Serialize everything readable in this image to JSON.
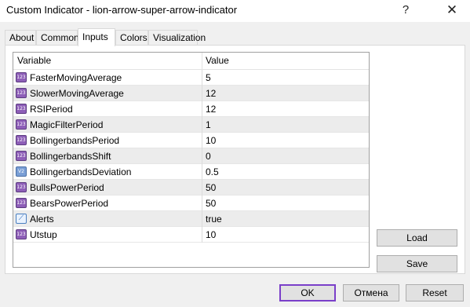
{
  "window": {
    "title": "Custom Indicator - lion-arrow-super-arrow-indicator",
    "help_glyph": "?",
    "close_glyph": "✕"
  },
  "tabs": [
    {
      "label": "About"
    },
    {
      "label": "Common"
    },
    {
      "label": "Inputs",
      "active": true
    },
    {
      "label": "Colors"
    },
    {
      "label": "Visualization"
    }
  ],
  "grid": {
    "headers": {
      "variable": "Variable",
      "value": "Value"
    },
    "rows": [
      {
        "icon": "int-icon",
        "badge": "123",
        "name": "FasterMovingAverage",
        "value": "5"
      },
      {
        "icon": "int-icon",
        "badge": "123",
        "name": "SlowerMovingAverage",
        "value": "12"
      },
      {
        "icon": "int-icon",
        "badge": "123",
        "name": "RSIPeriod",
        "value": "12"
      },
      {
        "icon": "int-icon",
        "badge": "123",
        "name": "MagicFilterPeriod",
        "value": "1"
      },
      {
        "icon": "int-icon",
        "badge": "123",
        "name": "BollingerbandsPeriod",
        "value": "10"
      },
      {
        "icon": "int-icon",
        "badge": "123",
        "name": "BollingerbandsShift",
        "value": "0"
      },
      {
        "icon": "double-icon",
        "badge": "V2",
        "name": "BollingerbandsDeviation",
        "value": "0.5"
      },
      {
        "icon": "int-icon",
        "badge": "123",
        "name": "BullsPowerPeriod",
        "value": "50"
      },
      {
        "icon": "int-icon",
        "badge": "123",
        "name": "BearsPowerPeriod",
        "value": "50"
      },
      {
        "icon": "bool-icon",
        "badge": "⟋",
        "name": "Alerts",
        "value": "true"
      },
      {
        "icon": "int-icon",
        "badge": "123",
        "name": "Utstup",
        "value": "10"
      }
    ]
  },
  "buttons": {
    "load": "Load",
    "save": "Save",
    "ok": "OK",
    "cancel": "Отмена",
    "reset": "Reset"
  },
  "colors": {
    "ok_border": "#7a3fc9",
    "row_alt": "#ececec",
    "int_icon": "#8e5fb8"
  }
}
